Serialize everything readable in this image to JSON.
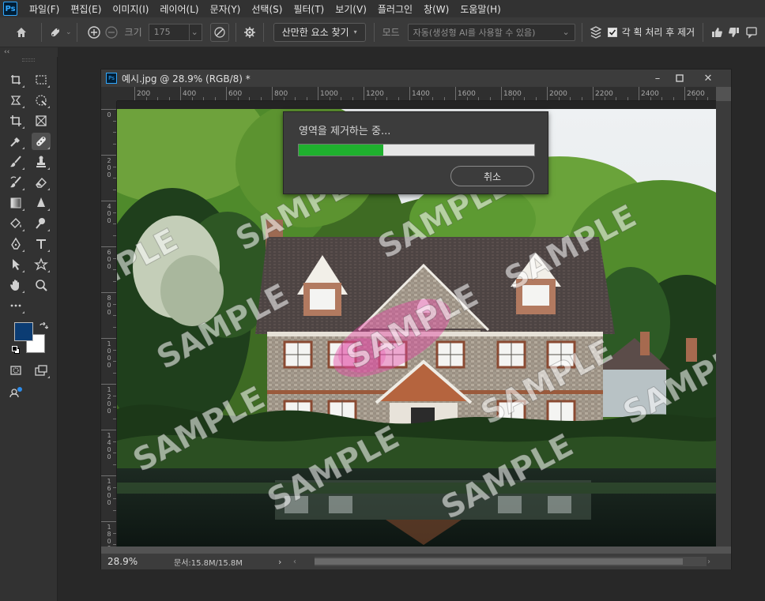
{
  "app": {
    "logo": "Ps",
    "menu": [
      "파일(F)",
      "편집(E)",
      "이미지(I)",
      "레이어(L)",
      "문자(Y)",
      "선택(S)",
      "필터(T)",
      "보기(V)",
      "플러그인",
      "창(W)",
      "도움말(H)"
    ]
  },
  "options": {
    "size_label": "크기",
    "size_value": "175",
    "find_button": "산만한 요소 찾기",
    "mode_label": "모드",
    "mode_value": "자동(생성형 AI를 사용할 수 있음)",
    "each_stroke_label": "각 획 처리 후 제거",
    "each_stroke_checked": true
  },
  "toolbar": {
    "collapse_label": "‹‹",
    "foreground_color": "#0b3c73",
    "background_color": "#ffffff"
  },
  "document": {
    "title": "예시.jpg @ 28.9% (RGB/8) *",
    "zoom": "28.9%",
    "doc_size": "문서:15.8M/15.8M",
    "ruler_top_labels": [
      "200",
      "400",
      "600",
      "800",
      "1000",
      "1200",
      "1400",
      "1600",
      "1800",
      "2000",
      "2200",
      "2400",
      "2600"
    ],
    "ruler_left_labels": [
      "0",
      "200",
      "400",
      "600",
      "800",
      "1000",
      "1200",
      "1400",
      "1600",
      "1800"
    ],
    "watermark_text": "SAMPLE"
  },
  "dialog": {
    "message": "영역을 제거하는 중...",
    "progress": 0.36,
    "cancel_label": "취소",
    "progress_color": "#1fb02e"
  }
}
